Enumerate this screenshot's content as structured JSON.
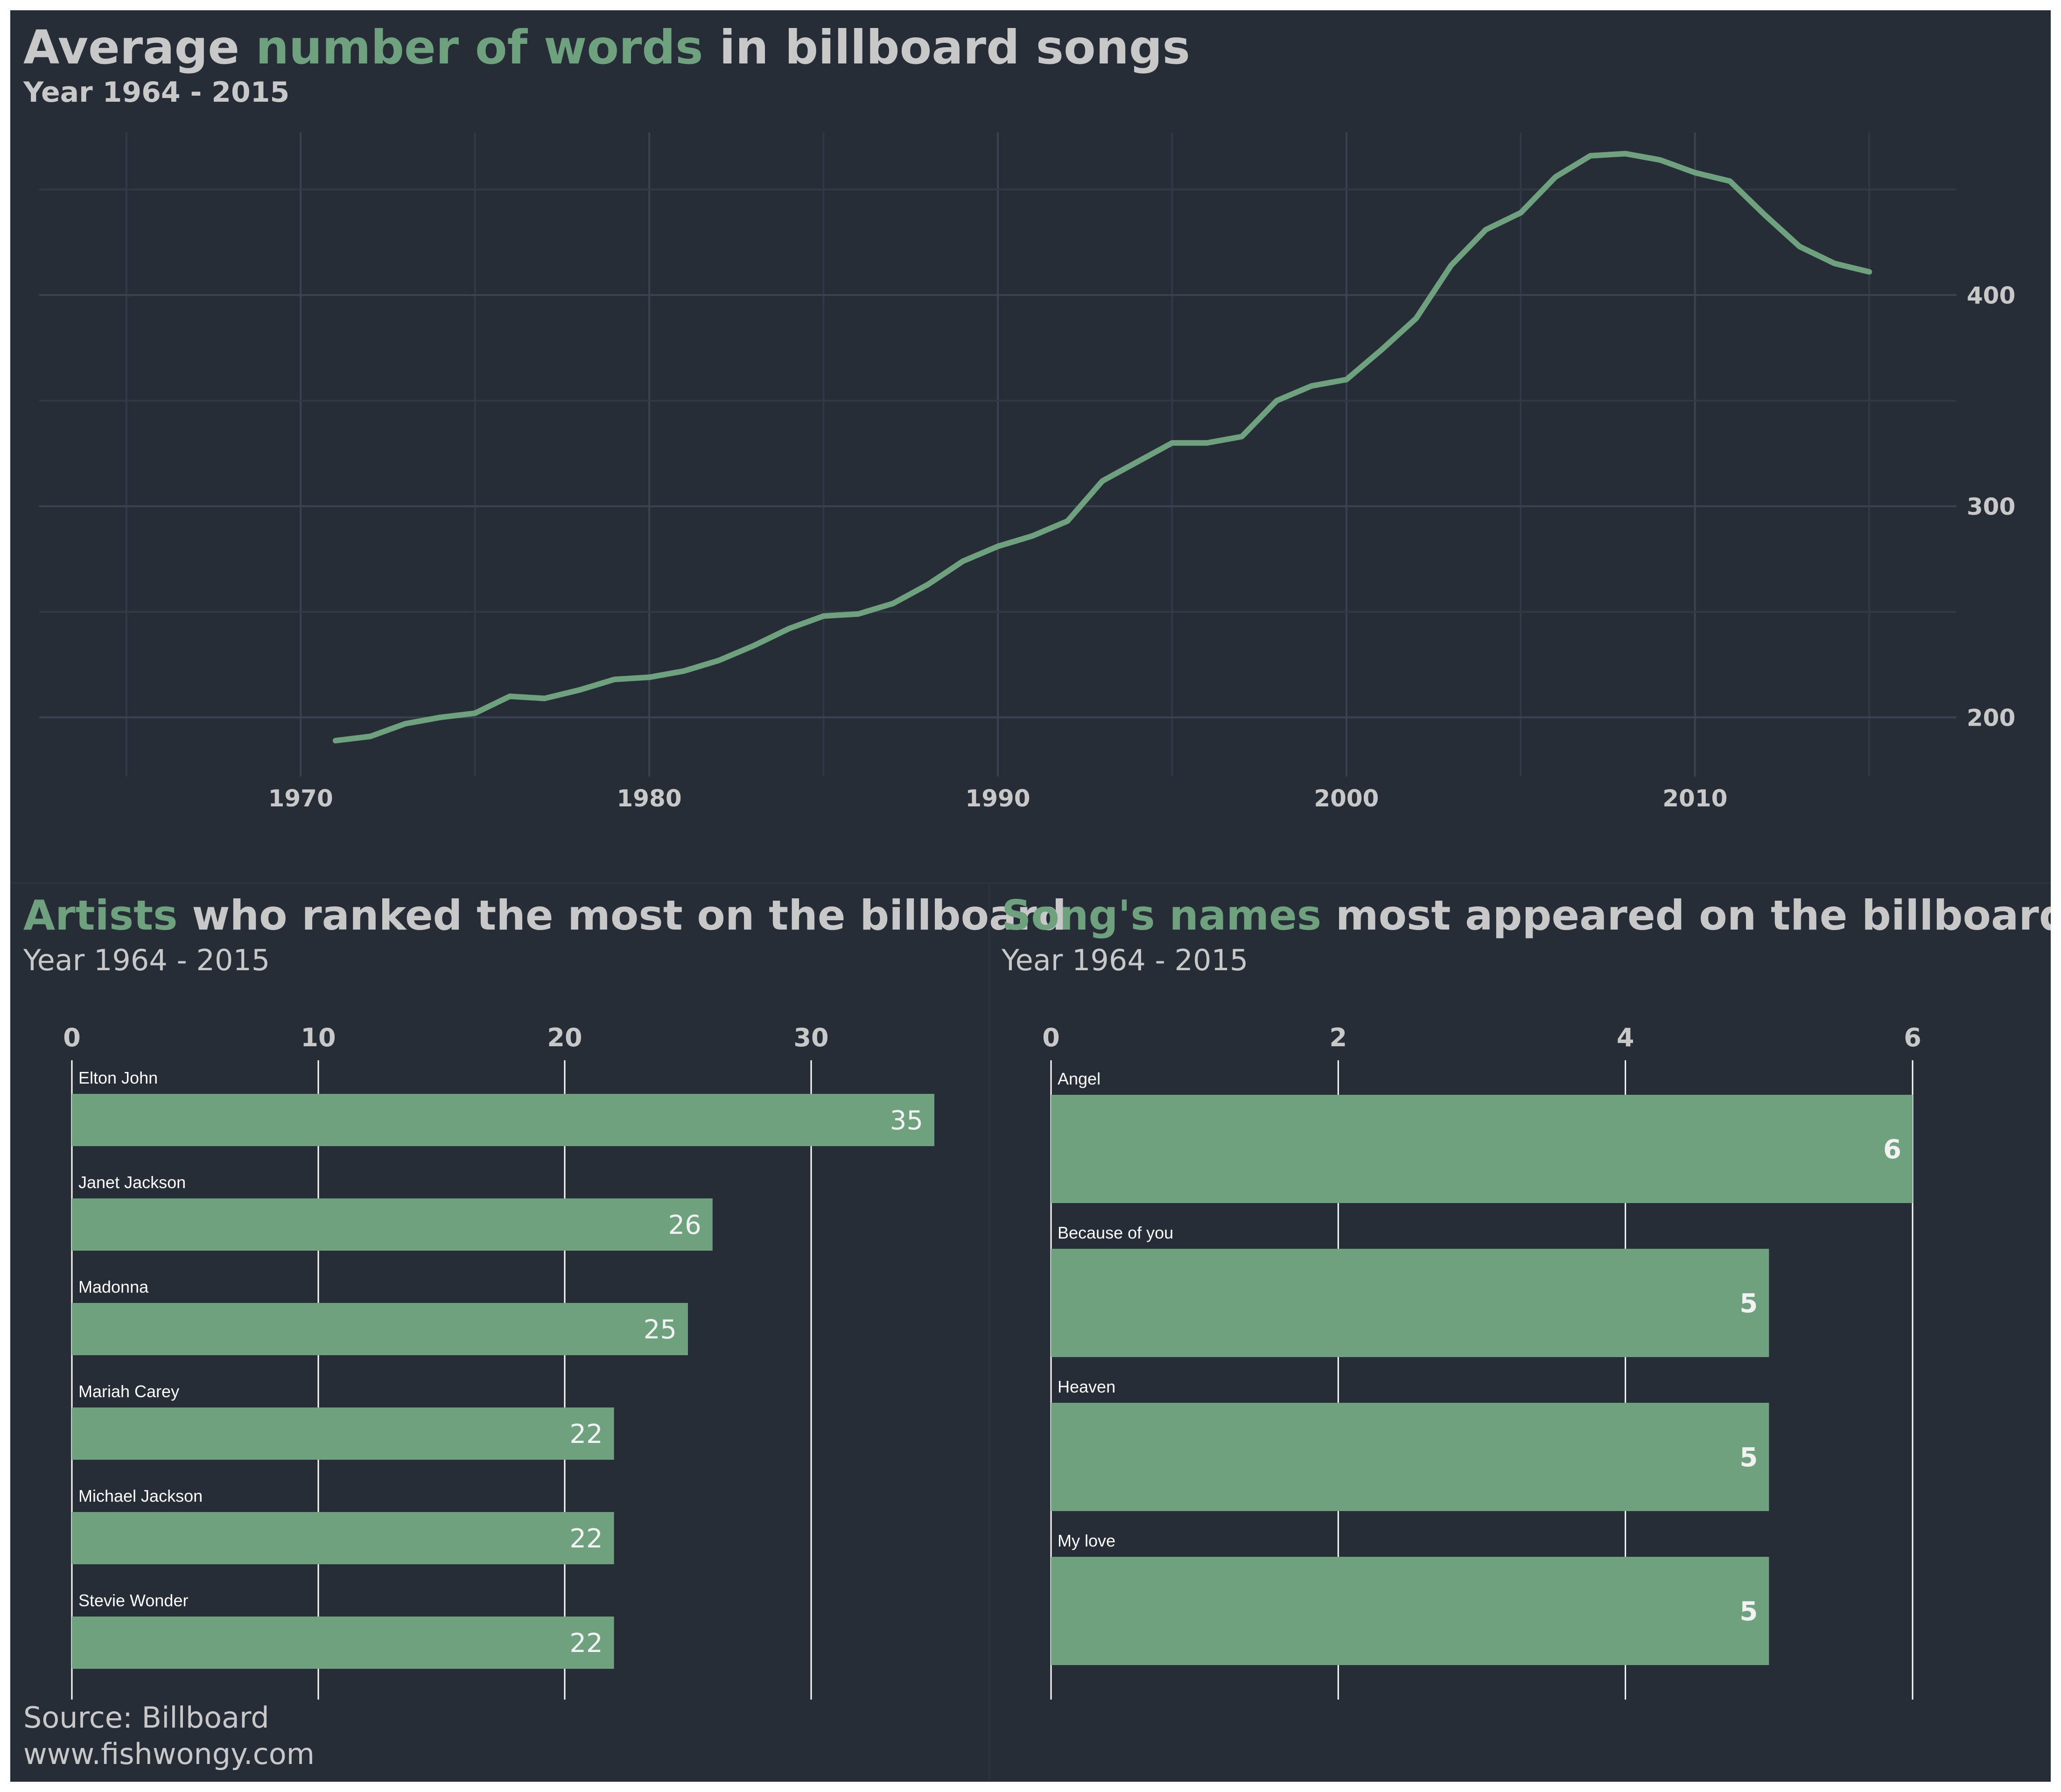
{
  "colors": {
    "background": "#262d37",
    "accent": "#6ea27e",
    "text": "#c8c8c8",
    "grid_major": "#3a4450",
    "grid_minor": "#313945"
  },
  "top": {
    "title_pre": "Average ",
    "title_hl": "number of words",
    "title_post": " in billboard songs",
    "subtitle": "Year 1964 - 2015"
  },
  "left": {
    "title_hl": "Artists",
    "title_post": " who ranked the most on the billboard",
    "subtitle": "Year 1964 - 2015"
  },
  "right": {
    "title_hl": "Song's names",
    "title_post": " most appeared on the billboard",
    "subtitle": "Year 1964 - 2015"
  },
  "footer": {
    "source": "Source: Billboard",
    "site": "www.fishwongy.com"
  },
  "chart_data": [
    {
      "type": "line",
      "title": "Average number of words in billboard songs",
      "subtitle": "Year 1964 - 2015",
      "x": [
        1971,
        1972,
        1973,
        1974,
        1975,
        1976,
        1977,
        1978,
        1979,
        1980,
        1981,
        1982,
        1983,
        1984,
        1985,
        1986,
        1987,
        1988,
        1989,
        1990,
        1991,
        1992,
        1993,
        1994,
        1995,
        1996,
        1997,
        1998,
        1999,
        2000,
        2001,
        2002,
        2003,
        2004,
        2005,
        2006,
        2007,
        2008,
        2009,
        2010,
        2011,
        2012,
        2013,
        2014,
        2015
      ],
      "y": [
        189,
        191,
        197,
        200,
        202,
        210,
        209,
        213,
        218,
        219,
        222,
        227,
        234,
        242,
        248,
        249,
        254,
        263,
        274,
        281,
        286,
        293,
        312,
        321,
        330,
        330,
        333,
        350,
        357,
        360,
        374,
        389,
        414,
        431,
        439,
        456,
        466,
        467,
        464,
        458,
        454,
        438,
        423,
        415,
        411
      ],
      "xlim": [
        1962.5,
        2017.5
      ],
      "ylim": [
        172,
        477
      ],
      "xticks": [
        1970,
        1980,
        1990,
        2000,
        2010
      ],
      "yticks": [
        200,
        300,
        400
      ],
      "y_axis_side": "right",
      "grid": true
    },
    {
      "type": "bar",
      "orientation": "horizontal",
      "title": "Artists who ranked the most on the billboard",
      "subtitle": "Year 1964 - 2015",
      "categories": [
        "Elton John",
        "Janet Jackson",
        "Madonna",
        "Mariah Carey",
        "Michael Jackson",
        "Stevie Wonder"
      ],
      "values": [
        35,
        26,
        25,
        22,
        22,
        22
      ],
      "xlim": [
        0,
        36.5
      ],
      "xticks": [
        0,
        10,
        20,
        30
      ],
      "x_axis_side": "top"
    },
    {
      "type": "bar",
      "orientation": "horizontal",
      "title": "Song's names most appeared on the billboard",
      "subtitle": "Year 1964 - 2015",
      "categories": [
        "Angel",
        "Because of you",
        "Heaven",
        "My love"
      ],
      "values": [
        6,
        5,
        5,
        5
      ],
      "xlim": [
        0,
        6.3
      ],
      "xticks": [
        0,
        2,
        4,
        6
      ],
      "x_axis_side": "top"
    }
  ]
}
